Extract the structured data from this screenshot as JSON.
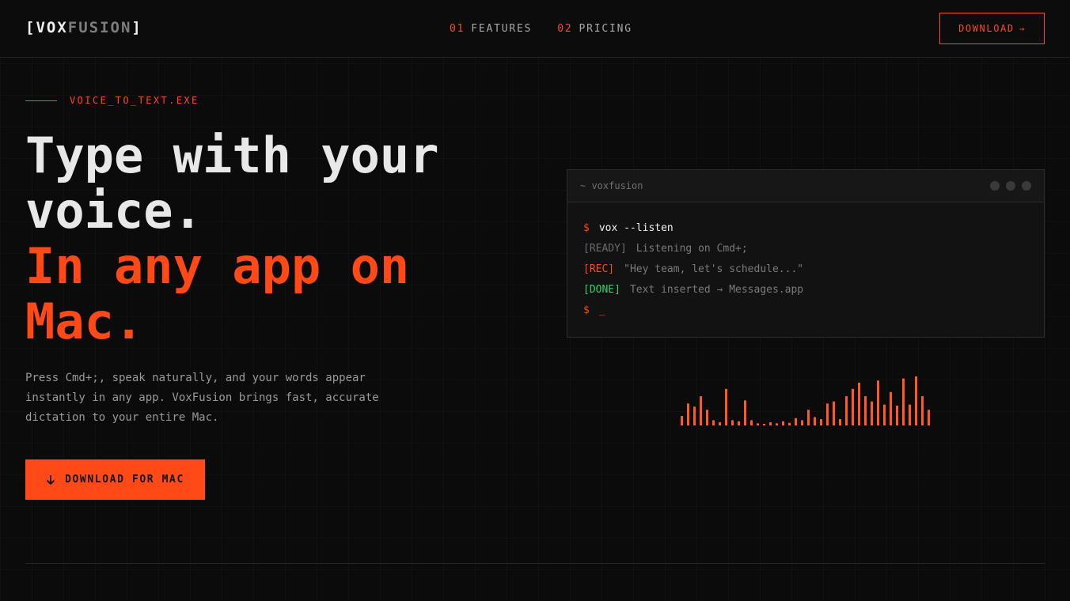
{
  "header": {
    "logo_a": "[VOX",
    "logo_b": "FUSION",
    "logo_c": "]",
    "nav": [
      {
        "num": "01",
        "label": "FEATURES"
      },
      {
        "num": "02",
        "label": "PRICING"
      }
    ],
    "download_label": "DOWNLOAD",
    "download_arrow": "→"
  },
  "hero": {
    "eyebrow": "VOICE_TO_TEXT.EXE",
    "headline_1": "Type with your voice.",
    "headline_2": "In any app on Mac.",
    "lede": "Press Cmd+;, speak naturally, and your words appear instantly in any app. VoxFusion brings fast, accurate dictation to your entire Mac.",
    "cta_label": "DOWNLOAD FOR MAC"
  },
  "terminal": {
    "title": "~ voxfusion",
    "prompt": "$",
    "command": "vox --listen",
    "lines": [
      {
        "tag": "[READY]",
        "text": "Listening on Cmd+;"
      },
      {
        "tag": "[REC]",
        "text": "\"Hey team, let's schedule...\""
      },
      {
        "tag": "[DONE]",
        "text": "Text inserted → Messages.app"
      }
    ],
    "cursor": "_"
  },
  "waveform": {
    "color": "#ff5a24",
    "levels": [
      0.18,
      0.42,
      0.36,
      0.56,
      0.3,
      0.1,
      0.06,
      0.7,
      0.1,
      0.08,
      0.48,
      0.1,
      0.04,
      0.03,
      0.06,
      0.04,
      0.08,
      0.05,
      0.14,
      0.1,
      0.3,
      0.16,
      0.12,
      0.42,
      0.46,
      0.12,
      0.56,
      0.7,
      0.82,
      0.56,
      0.46,
      0.86,
      0.4,
      0.64,
      0.38,
      0.9,
      0.4,
      0.94,
      0.56,
      0.3
    ]
  },
  "colors": {
    "accent": "#ff4a17",
    "done": "#2fd16f",
    "background": "#0b0b0b"
  }
}
